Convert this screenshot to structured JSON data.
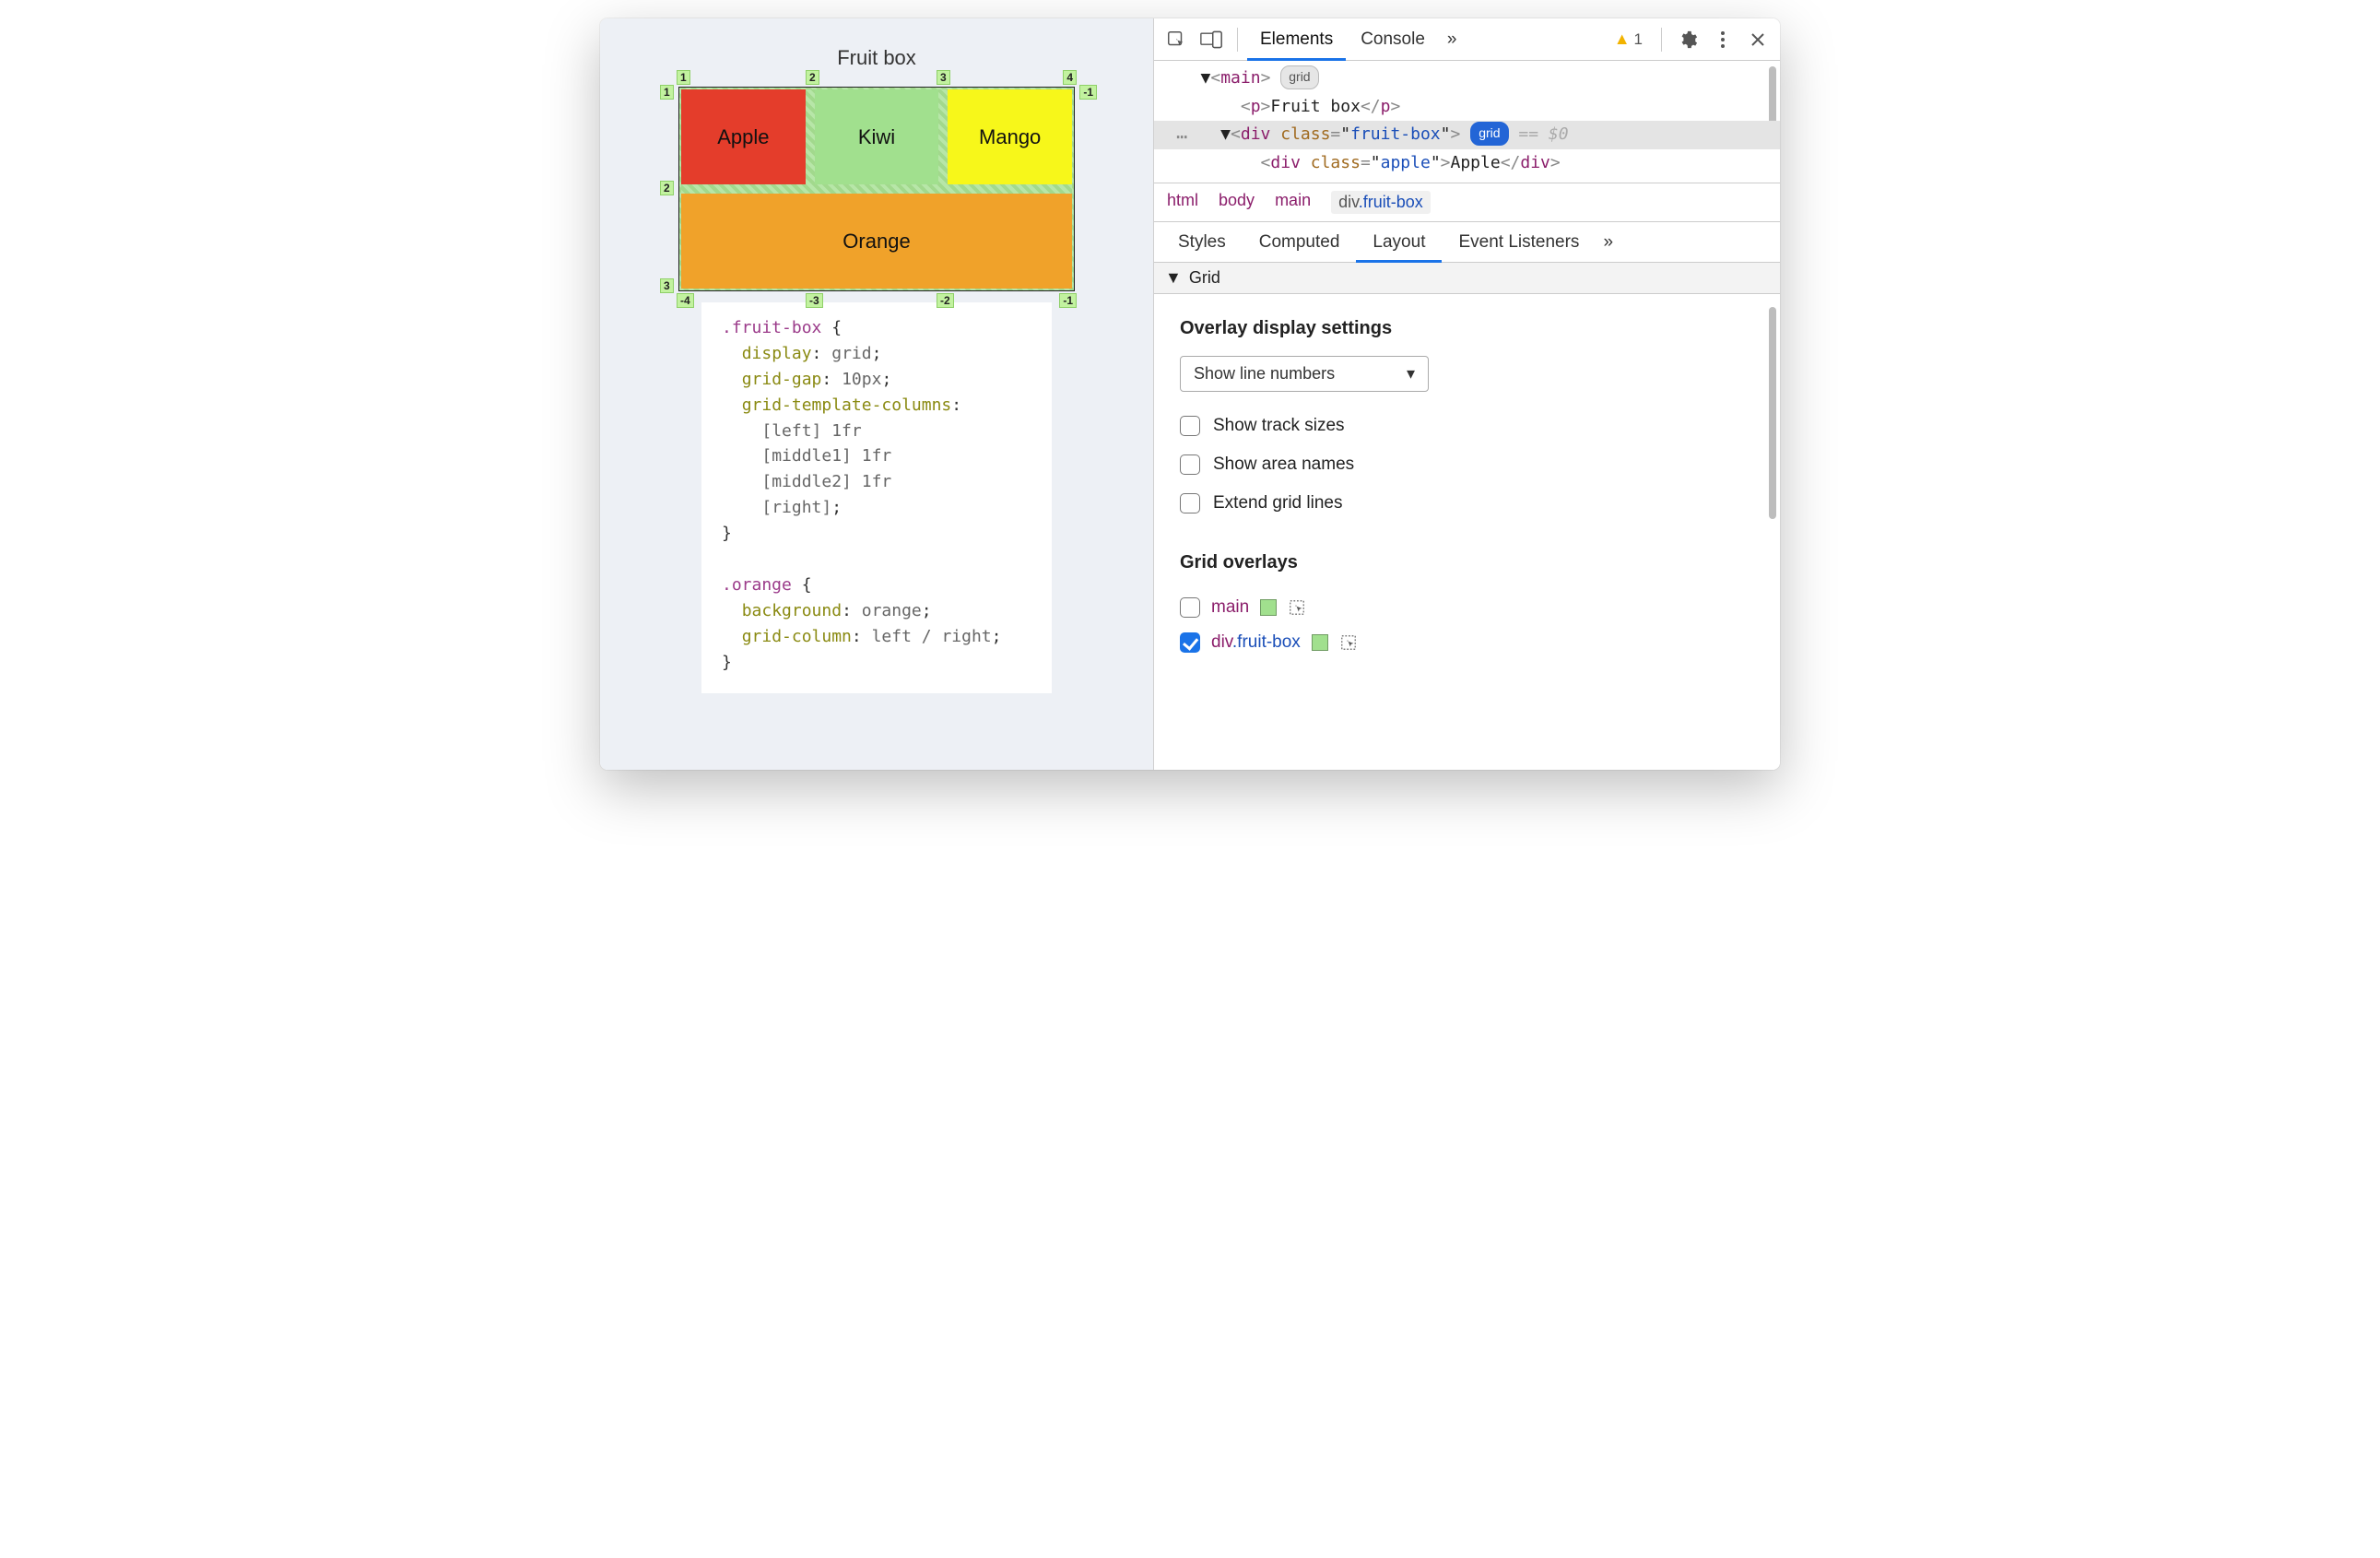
{
  "preview": {
    "title": "Fruit box",
    "cells": {
      "apple": "Apple",
      "kiwi": "Kiwi",
      "mango": "Mango",
      "orange": "Orange"
    },
    "line_numbers_top": [
      "1",
      "2",
      "3",
      "4"
    ],
    "line_numbers_bottom": [
      "-4",
      "-3",
      "-2",
      "-1"
    ],
    "line_numbers_left": [
      "1",
      "2",
      "3"
    ],
    "line_numbers_right": [
      "-1"
    ]
  },
  "css": {
    "rule1_selector": ".fruit-box",
    "rule1_lines": [
      "display: grid;",
      "grid-gap: 10px;",
      "grid-template-columns:",
      "  [left] 1fr",
      "  [middle1] 1fr",
      "  [middle2] 1fr",
      "  [right];"
    ],
    "rule2_selector": ".orange",
    "rule2_lines": [
      "background: orange;",
      "grid-column: left / right;"
    ]
  },
  "devtools": {
    "tabs": {
      "elements": "Elements",
      "console": "Console",
      "more": "»"
    },
    "warning_count": "1",
    "dom": {
      "l0_tag": "main",
      "l0_badge": "grid",
      "l1_tag": "p",
      "l1_text": "Fruit box",
      "l2_tag": "div",
      "l2_attr_name": "class",
      "l2_attr_val": "fruit-box",
      "l2_badge": "grid",
      "l2_suffix": "== $0",
      "l3_tag": "div",
      "l3_attr_name": "class",
      "l3_attr_val": "apple",
      "l3_text": "Apple"
    },
    "crumbs": [
      "html",
      "body",
      "main"
    ],
    "crumb_active_el": "div",
    "crumb_active_class": ".fruit-box",
    "subtabs": {
      "styles": "Styles",
      "computed": "Computed",
      "layout": "Layout",
      "listeners": "Event Listeners",
      "more": "»"
    },
    "section": "Grid",
    "overlay_settings_title": "Overlay display settings",
    "line_numbers_select": "Show line numbers",
    "opt_track_sizes": "Show track sizes",
    "opt_area_names": "Show area names",
    "opt_extend_lines": "Extend grid lines",
    "grid_overlays_title": "Grid overlays",
    "overlay_items": [
      {
        "checked": false,
        "el": "main",
        "class": "",
        "color": "#a1e08e"
      },
      {
        "checked": true,
        "el": "div",
        "class": ".fruit-box",
        "color": "#a1e08e"
      }
    ]
  }
}
